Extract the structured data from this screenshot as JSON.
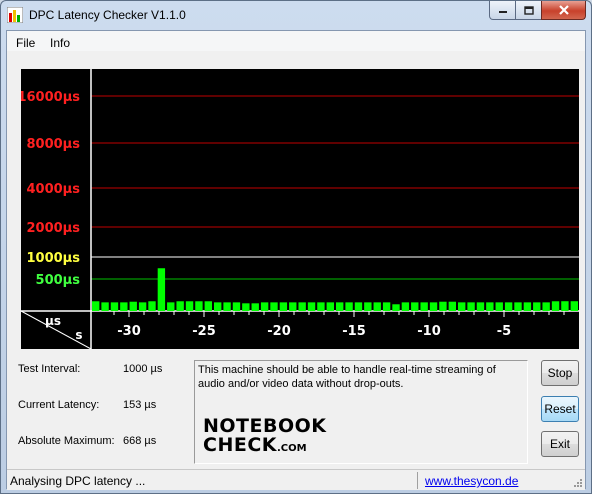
{
  "window": {
    "title": "DPC Latency Checker V1.1.0",
    "icon": "bar-chart-icon"
  },
  "menu": [
    {
      "label": "File"
    },
    {
      "label": "Info"
    }
  ],
  "graph": {
    "y_labels": [
      {
        "text": "16000µs",
        "color": "#ff2020",
        "line": "#c00000"
      },
      {
        "text": "8000µs",
        "color": "#ff2020",
        "line": "#c00000"
      },
      {
        "text": "4000µs",
        "color": "#ff2020",
        "line": "#c00000"
      },
      {
        "text": "2000µs",
        "color": "#ff2020",
        "line": "#c00000"
      },
      {
        "text": "1000µs",
        "color": "#ffff40",
        "line": "#ffffff"
      },
      {
        "text": "500µs",
        "color": "#40ff40",
        "line": "#00c000"
      }
    ],
    "unit_y": "µs",
    "unit_x": "s",
    "x_ticks": [
      "-30",
      "-25",
      "-20",
      "-15",
      "-10",
      "-5"
    ],
    "bar_color": "#00ff00",
    "bars_us": [
      152,
      135,
      135,
      135,
      145,
      135,
      152,
      668,
      135,
      152,
      152,
      152,
      152,
      135,
      135,
      135,
      120,
      120,
      135,
      135,
      135,
      135,
      135,
      135,
      135,
      135,
      135,
      135,
      135,
      135,
      135,
      135,
      105,
      135,
      135,
      135,
      135,
      145,
      145,
      135,
      135,
      135,
      135,
      135,
      135,
      135,
      135,
      135,
      135,
      152,
      153,
      153
    ]
  },
  "info": {
    "test_interval": {
      "label": "Test Interval:",
      "value": "1000 µs"
    },
    "current_latency": {
      "label": "Current Latency:",
      "value": "153 µs"
    },
    "absolute_maximum": {
      "label": "Absolute Maximum:",
      "value": "668 µs"
    }
  },
  "message": "This machine should be able to handle real-time streaming of audio and/or video data without drop-outs.",
  "logo": {
    "line1": "NOTEBOOK",
    "line2": "CHECK",
    "suffix": ".COM"
  },
  "buttons": {
    "stop": "Stop",
    "reset": "Reset",
    "exit": "Exit"
  },
  "status": {
    "text": "Analysing DPC latency ...",
    "link": "www.thesycon.de"
  }
}
